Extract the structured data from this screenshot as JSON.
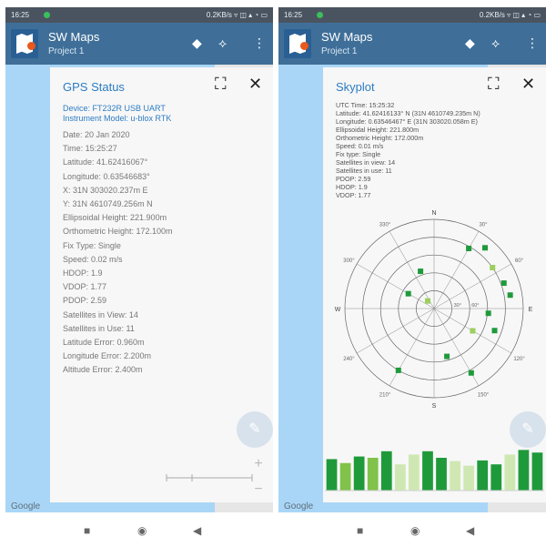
{
  "status_bar": {
    "left": {
      "time": "16:25"
    },
    "right": {
      "time": "16:25"
    },
    "speed_left": "0.2KB/s ▿ ◫ ▴ ◔ ▭",
    "speed_right": "0.2KB/s ▿ ◫ ▴ ◔ ▭"
  },
  "app": {
    "title": "SW Maps",
    "project": "Project 1",
    "icons": [
      "layers-icon",
      "gnss-icon",
      "more-vert-icon"
    ]
  },
  "gps_panel": {
    "title": "GPS Status",
    "device_lines": [
      "Device: FT232R USB UART",
      "Instrument Model: u-blox RTK"
    ],
    "lines": [
      "Date: 20 Jan 2020",
      "Time: 15:25:27",
      "Latitude: 41.62416067°",
      "Longitude: 0.63546683°",
      "X: 31N 303020.237m E",
      "Y: 31N 4610749.256m N",
      "Ellipsoidal Height: 221.900m",
      "Orthometric Height: 172.100m",
      "Fix Type: Single",
      "Speed: 0.02 m/s",
      "HDOP: 1.9",
      "VDOP: 1.77",
      "PDOP: 2.59",
      "Satellites in View: 14",
      "Satellites in Use: 11",
      "Latitude Error: 0.960m",
      "Longitude Error: 2.200m",
      "Altitude Error: 2.400m"
    ]
  },
  "skyplot_panel": {
    "title": "Skyplot",
    "lines": [
      "UTC Time: 15:25:32",
      "Latitude: 41.62416133° N (31N 4610749.235m N)",
      "Longitude: 0.63546467° E (31N 303020.058m E)",
      "Ellipsoidal Height: 221.800m",
      "Orthometric Height: 172.000m",
      "Speed: 0.01 m/s",
      "Fix type: Single",
      "Satellites in view: 14",
      "Satellites in use: 11",
      "PDOP: 2.59",
      "HDOP: 1.9",
      "VDOP: 1.77"
    ],
    "cardinal": [
      "N",
      "E",
      "S",
      "W"
    ],
    "azimuth_labels": [
      "30°",
      "60°",
      "120°",
      "150°",
      "210°",
      "240°",
      "300°",
      "330°"
    ],
    "elevation_labels": [
      "30°",
      "60°"
    ]
  },
  "chart_data": {
    "type": "bar",
    "title": "",
    "description": "Satellite signal strength bars (Skyplot screen)",
    "bar_count": 16,
    "values": [
      0.48,
      0.42,
      0.52,
      0.5,
      0.6,
      0.4,
      0.55,
      0.6,
      0.5,
      0.45,
      0.38,
      0.46,
      0.4,
      0.55,
      0.62,
      0.58
    ],
    "colors": [
      "#1f9a3b",
      "#80c24a",
      "#1f9a3b",
      "#80c24a",
      "#1f9a3b",
      "#cfe8b3",
      "#cfe8b3",
      "#1f9a3b",
      "#1f9a3b",
      "#cfe8b3",
      "#cfe8b3",
      "#1f9a3b",
      "#1f9a3b",
      "#cfe8b3",
      "#1f9a3b",
      "#1f9a3b"
    ],
    "value_scale": "relative 0-1",
    "ylim": [
      0,
      1
    ]
  },
  "skyplot_satellites": [
    {
      "az": 30,
      "el": 20,
      "used": true
    },
    {
      "az": 40,
      "el": 10,
      "used": true
    },
    {
      "az": 55,
      "el": 18,
      "used": false
    },
    {
      "az": 70,
      "el": 15,
      "used": true
    },
    {
      "az": 80,
      "el": 12,
      "used": true
    },
    {
      "az": 95,
      "el": 35,
      "used": true
    },
    {
      "az": 110,
      "el": 25,
      "used": true
    },
    {
      "az": 120,
      "el": 45,
      "used": false
    },
    {
      "az": 150,
      "el": 15,
      "used": true
    },
    {
      "az": 165,
      "el": 40,
      "used": true
    },
    {
      "az": 210,
      "el": 18,
      "used": true
    },
    {
      "az": 300,
      "el": 60,
      "used": true
    },
    {
      "az": 320,
      "el": 80,
      "used": false
    },
    {
      "az": 340,
      "el": 50,
      "used": true
    }
  ],
  "map": {
    "attribution": "Google"
  },
  "colors": {
    "app_bar": "#3f6f98",
    "status_bar": "#4a5460",
    "accent": "#2c7cc3",
    "map": "#a9d6f6"
  },
  "nav_icons": [
    "square-nav-icon",
    "circle-nav-icon",
    "back-nav-icon"
  ]
}
